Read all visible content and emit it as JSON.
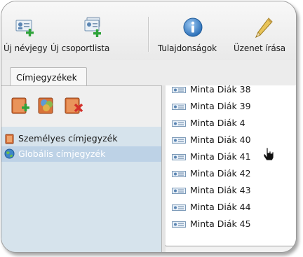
{
  "toolbar": {
    "items": [
      {
        "label": "Új névjegy",
        "icon": "new-contact-icon"
      },
      {
        "label": "Új csoportlista",
        "icon": "new-group-list-icon"
      },
      {
        "label": "Tulajdonságok",
        "icon": "properties-info-icon"
      },
      {
        "label": "Üzenet írása",
        "icon": "write-message-pencil-icon"
      }
    ]
  },
  "tabs": [
    {
      "label": "Címjegyzékek"
    }
  ],
  "address_book_actions": [
    {
      "icon": "add-address-book-icon"
    },
    {
      "icon": "address-book-users-icon"
    },
    {
      "icon": "delete-address-book-icon"
    }
  ],
  "address_books": [
    {
      "label": "Személyes címjegyzék",
      "icon": "personal-book-icon"
    },
    {
      "label": "Globális címjegyzék",
      "icon": "globe-icon",
      "selected": true
    }
  ],
  "contacts": [
    {
      "name": "Minta Diák 38"
    },
    {
      "name": "Minta Diák 39"
    },
    {
      "name": "Minta Diák 4"
    },
    {
      "name": "Minta Diák 40"
    },
    {
      "name": "Minta Diák 41"
    },
    {
      "name": "Minta Diák 42"
    },
    {
      "name": "Minta Diák 43"
    },
    {
      "name": "Minta Diák 44"
    },
    {
      "name": "Minta Diák 45"
    }
  ],
  "colors": {
    "selection": "#bdd2e6",
    "tree_background": "#d6e3ec",
    "selected_text": "#ffffff"
  }
}
